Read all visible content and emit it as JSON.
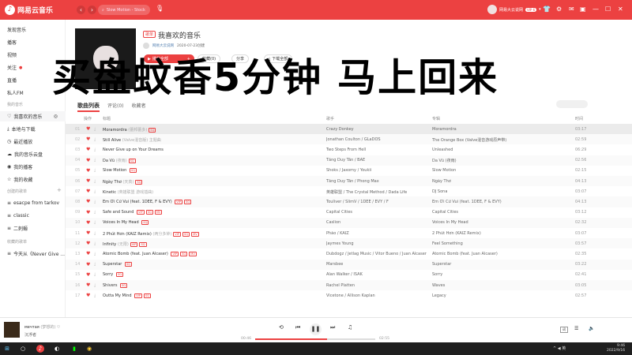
{
  "app": {
    "name": "网易云音乐",
    "search_text": "Slow Motion - Stock",
    "username": "网易大云说网",
    "vip": "VIP 6"
  },
  "sidebar": {
    "top": [
      "发现音乐",
      "播客",
      "视频",
      "关注",
      "直播",
      "私人FM"
    ],
    "my_music_label": "我的音乐",
    "my": [
      "我喜欢的音乐",
      "本地与下载",
      "最近播放",
      "我的音乐云盘",
      "我的播客",
      "我的收藏"
    ],
    "created_label": "创建的歌单",
    "created": [
      "esacpe from tarkov",
      "classic",
      "二刺螈"
    ],
    "collected_label": "收藏的歌单",
    "collected": [
      "今天从《Never Give ..."
    ]
  },
  "playlist": {
    "tag": "歌单",
    "title": "我喜欢的音乐",
    "creator": "网易大云说网",
    "created_date": "2020-07-23创建",
    "play_all": "播放全部",
    "collect": "收藏(0)",
    "share": "分享",
    "download": "下载全部"
  },
  "overlay_text": "买盘蚊香5分钟 马上回来",
  "tabs": [
    "歌曲列表",
    "评论(0)",
    "收藏者"
  ],
  "table_headers": {
    "op": "操作",
    "title": "标题",
    "artist": "歌手",
    "album": "专辑",
    "time": "时间"
  },
  "songs": [
    {
      "idx": "01",
      "title": "Moramordra",
      "alias": "(蕾邦蕾多)",
      "tags": [
        "SQ"
      ],
      "artist": "Crazy Donkey",
      "album": "Moramordra",
      "time": "03:17"
    },
    {
      "idx": "02",
      "title": "Still Alive",
      "alias": "(Valve混音版) 主题曲",
      "tags": [],
      "artist": "Jonathan Coulton / GLaDOS",
      "album": "The Orange Box (Valve混音游戏原声带)",
      "time": "02:59"
    },
    {
      "idx": "03",
      "title": "Never Give up on Your Dreams",
      "alias": "",
      "tags": [],
      "artist": "Two Steps From Hell",
      "album": "Unleashed",
      "time": "06:29"
    },
    {
      "idx": "04",
      "title": "Da Vũ",
      "alias": "(夜雨)",
      "tags": [
        "SQ"
      ],
      "artist": "Tăng Duy Tân / BAE",
      "album": "Da Vũ (夜雨)",
      "time": "02:56"
    },
    {
      "idx": "05",
      "title": "Slow Motion",
      "alias": "",
      "tags": [
        "SQ"
      ],
      "artist": "Shoks / Jaxomy / Youkii",
      "album": "Slow Motion",
      "time": "02:15"
    },
    {
      "idx": "06",
      "title": "Ngày Thơ",
      "alias": "(天真)",
      "tags": [
        "SQ"
      ],
      "artist": "Tăng Duy Tân / Phong Max",
      "album": "Ngày Thơ",
      "time": "04:13"
    },
    {
      "idx": "07",
      "title": "Kinetic",
      "alias": "(英雄联盟 游戏插曲)",
      "tags": [],
      "artist": "英雄联盟 / The Crystal Method / Dada Life",
      "album": "DJ Sona",
      "time": "03:07"
    },
    {
      "idx": "08",
      "title": "Em Ơi Cứ Vui (feat. 1DEE, F & EVY)",
      "alias": "",
      "tags": [
        "VIP",
        "SQ"
      ],
      "artist": "Touliver / SlimV / 1DEE / EVY / F",
      "album": "Em Ơi Cứ Vui (feat. 1DEE, F & EVY)",
      "time": "04:13"
    },
    {
      "idx": "09",
      "title": "Safe and Sound",
      "alias": "",
      "tags": [
        "VIP",
        "SQ",
        "MV"
      ],
      "artist": "Capital Cities",
      "album": "Capital Cities",
      "time": "03:12"
    },
    {
      "idx": "10",
      "title": "Voices In My Head",
      "alias": "",
      "tags": [
        "SQ"
      ],
      "artist": "Caslion",
      "album": "Voices In My Head",
      "time": "02:32"
    },
    {
      "idx": "11",
      "title": "2 Phút Hơn (KAIZ Remix)",
      "alias": "(两分多钟)",
      "tags": [
        "VIP",
        "SQ",
        "MV"
      ],
      "artist": "Pháo / KAIZ",
      "album": "2 Phút Hơn (KAIZ Remix)",
      "time": "03:07"
    },
    {
      "idx": "12",
      "title": "Infinity",
      "alias": "(无限)",
      "tags": [
        "VIP",
        "SQ"
      ],
      "artist": "Jaymes Young",
      "album": "Feel Something",
      "time": "03:57"
    },
    {
      "idx": "13",
      "title": "Atomic Bomb (feat. Juan Alcaser)",
      "alias": "",
      "tags": [
        "VIP",
        "SQ",
        "MV"
      ],
      "artist": "Dubdogz / Jetlag Music / Vitor Bueno / Juan Alcaser",
      "album": "Atomic Bomb (feat. Juan Alcaser)",
      "time": "02:35"
    },
    {
      "idx": "14",
      "title": "Superstar",
      "alias": "",
      "tags": [
        "SQ"
      ],
      "artist": "Marsbee",
      "album": "Superstar",
      "time": "03:22"
    },
    {
      "idx": "15",
      "title": "Sorry",
      "alias": "",
      "tags": [
        "SQ"
      ],
      "artist": "Alan Walker / ISÁK",
      "album": "Sorry",
      "time": "02:41"
    },
    {
      "idx": "16",
      "title": "Shivers",
      "alias": "",
      "tags": [
        "SQ"
      ],
      "artist": "Rachel Platten",
      "album": "Waves",
      "time": "03:05"
    },
    {
      "idx": "17",
      "title": "Outta My Mind",
      "alias": "",
      "tags": [
        "VIP",
        "SQ"
      ],
      "artist": "Vicetone / Allison Kaplan",
      "album": "Legacy",
      "time": "02:57"
    }
  ],
  "player": {
    "title": "мечтая",
    "alias": "(梦想的)",
    "artist": "沉浮者",
    "current": "00:46",
    "total": "02:55",
    "lyric_btn": "词"
  },
  "taskbar": {
    "tray": "^ ◀ 英",
    "time": "9:46",
    "date": "2022/9/16"
  },
  "colors": {
    "accent": "#ec4141"
  }
}
